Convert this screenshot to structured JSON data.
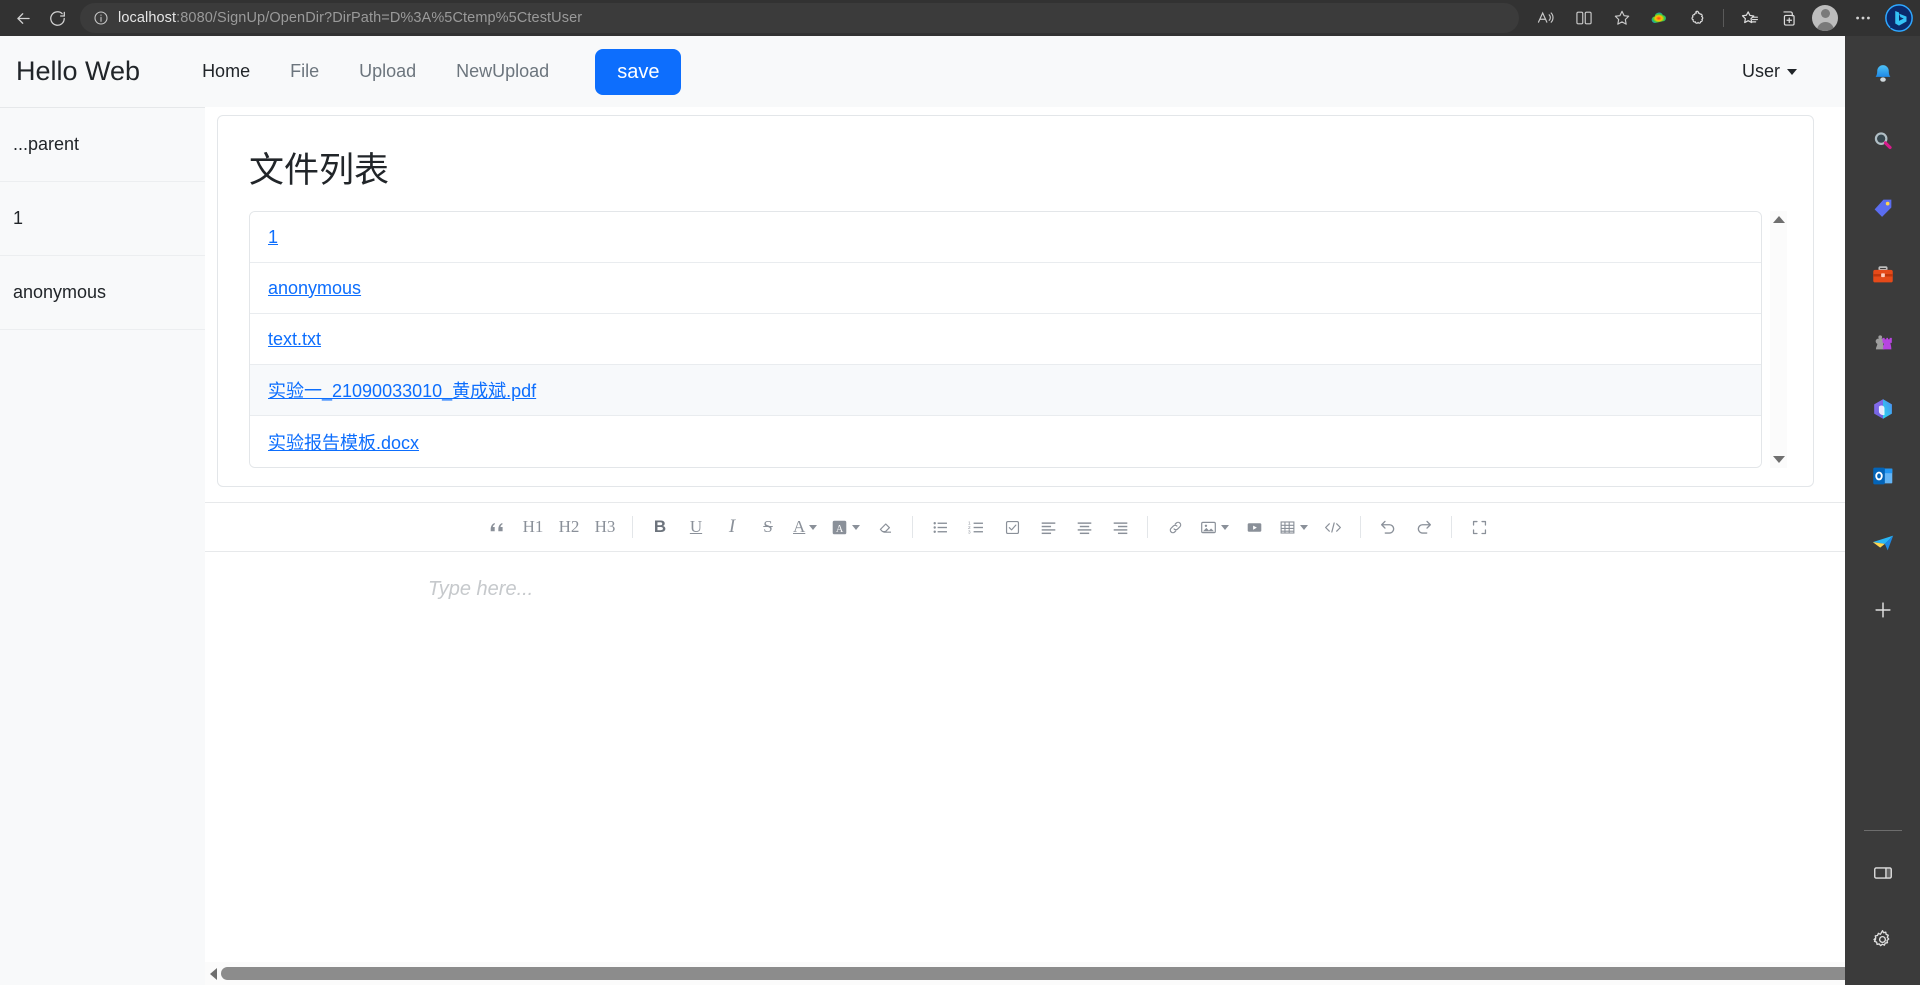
{
  "browser": {
    "back_label": "Back",
    "refresh_label": "Refresh",
    "url_host": "localhost",
    "url_rest": ":8080/SignUp/OpenDir?DirPath=D%3A%5Ctemp%5CtestUser",
    "url_full": "localhost:8080/SignUp/OpenDir?DirPath=D%3A%5Ctemp%5CtestUser",
    "toolbar_icons": [
      "read-aloud-icon",
      "split-screen-icon",
      "favorite-star-icon",
      "browser-essentials-icon",
      "extensions-icon",
      "favorites-list-icon",
      "collections-icon",
      "profile-avatar-icon",
      "settings-more-icon",
      "bing-chat-icon"
    ]
  },
  "navbar": {
    "brand": "Hello Web",
    "links": [
      {
        "label": "Home",
        "active": true
      },
      {
        "label": "File",
        "active": false
      },
      {
        "label": "Upload",
        "active": false
      },
      {
        "label": "NewUpload",
        "active": false
      }
    ],
    "save_label": "save",
    "user_label": "User"
  },
  "sidebar": {
    "items": [
      {
        "label": "...parent"
      },
      {
        "label": "1"
      },
      {
        "label": "anonymous"
      }
    ]
  },
  "file_card": {
    "title": "文件列表",
    "files": [
      {
        "name": "1",
        "highlight": false
      },
      {
        "name": "anonymous",
        "highlight": false
      },
      {
        "name": "text.txt",
        "highlight": false
      },
      {
        "name": "实验一_21090033010_黄成斌.pdf",
        "highlight": true
      },
      {
        "name": "实验报告模板.docx",
        "highlight": false
      }
    ]
  },
  "editor": {
    "placeholder": "Type here...",
    "toolbar": [
      {
        "name": "blockquote-icon",
        "label": "❝"
      },
      {
        "name": "heading-1-button",
        "label": "H1"
      },
      {
        "name": "heading-2-button",
        "label": "H2"
      },
      {
        "name": "heading-3-button",
        "label": "H3"
      },
      {
        "name": "bold-button",
        "label": "B"
      },
      {
        "name": "underline-button",
        "label": "U"
      },
      {
        "name": "italic-button",
        "label": "I"
      },
      {
        "name": "strikethrough-button",
        "label": "S"
      },
      {
        "name": "text-color-button",
        "label": "A"
      },
      {
        "name": "highlight-color-button",
        "label": "A"
      },
      {
        "name": "clear-format-button",
        "label": "eraser-icon"
      },
      {
        "name": "bullet-list-button",
        "label": "bullet-list-icon"
      },
      {
        "name": "numbered-list-button",
        "label": "numbered-list-icon"
      },
      {
        "name": "checklist-button",
        "label": "checklist-icon"
      },
      {
        "name": "align-left-button",
        "label": "align-left-icon"
      },
      {
        "name": "align-center-button",
        "label": "align-center-icon"
      },
      {
        "name": "align-right-button",
        "label": "align-right-icon"
      },
      {
        "name": "insert-link-button",
        "label": "link-icon"
      },
      {
        "name": "insert-image-button",
        "label": "image-icon"
      },
      {
        "name": "insert-video-button",
        "label": "video-icon"
      },
      {
        "name": "insert-table-button",
        "label": "table-icon"
      },
      {
        "name": "code-block-button",
        "label": "code-icon"
      },
      {
        "name": "undo-button",
        "label": "undo-icon"
      },
      {
        "name": "redo-button",
        "label": "redo-icon"
      },
      {
        "name": "fullscreen-button",
        "label": "fullscreen-icon"
      }
    ]
  },
  "edge_sidebar": {
    "icons": [
      "notifications-bell-icon",
      "search-icon",
      "shopping-tag-icon",
      "tools-briefcase-icon",
      "games-icon",
      "microsoft-365-icon",
      "outlook-icon",
      "drop-send-icon",
      "add-sidebar-app-icon"
    ],
    "bottom_icons": [
      "toggle-sidebar-icon",
      "settings-gear-icon"
    ]
  }
}
